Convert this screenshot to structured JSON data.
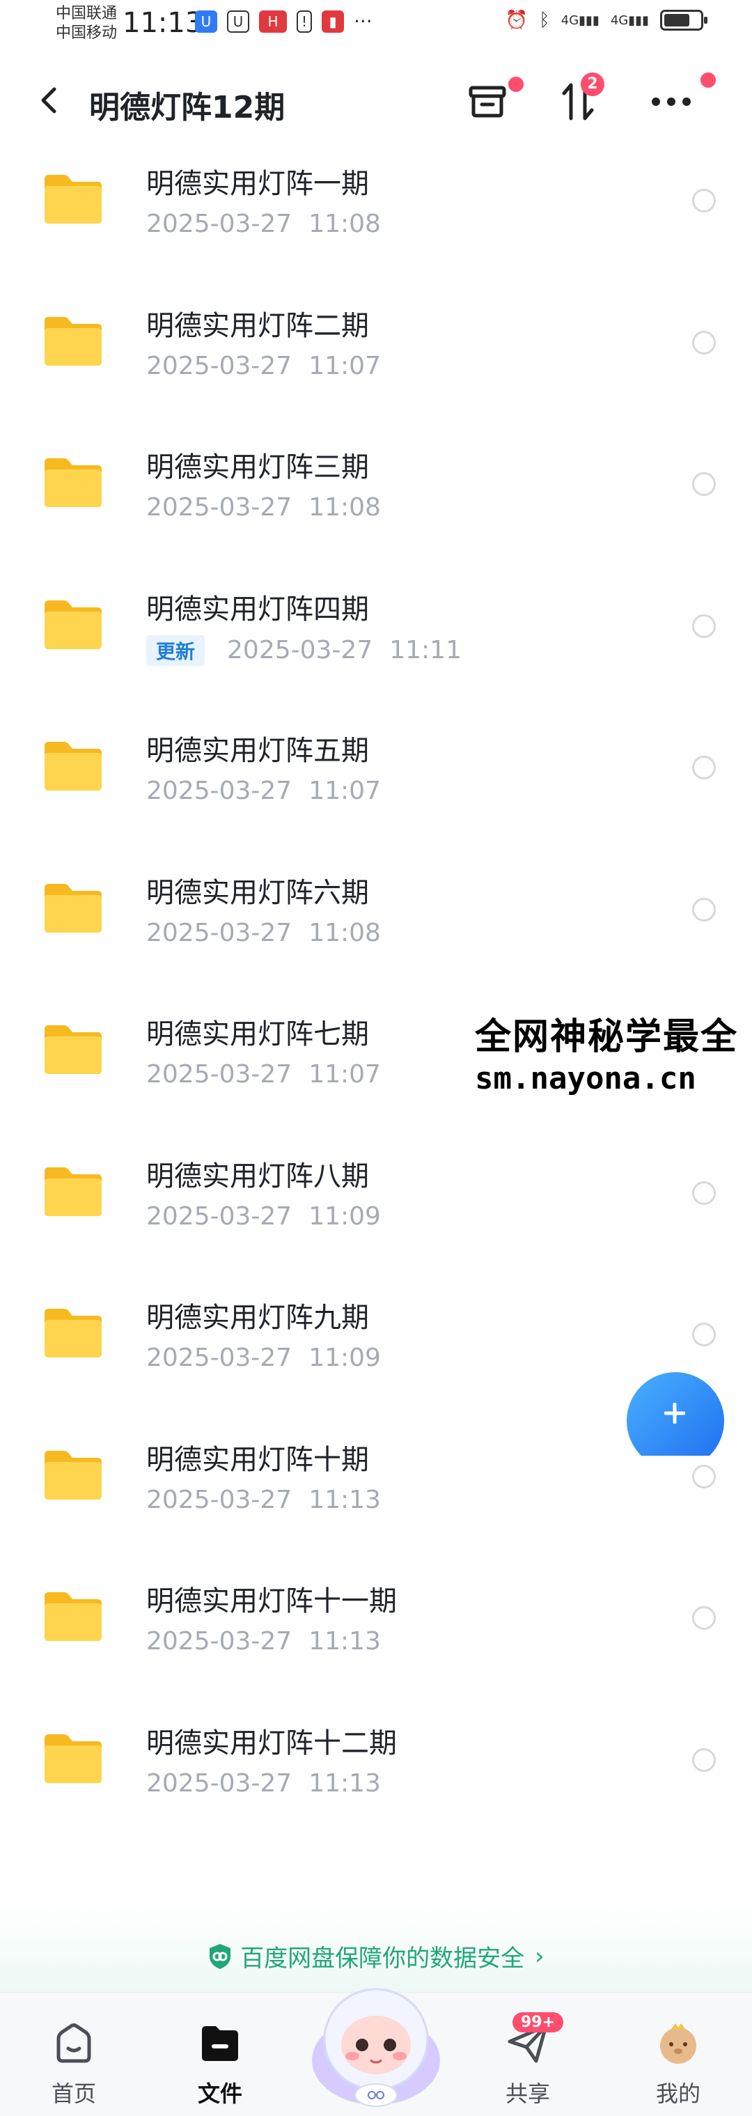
{
  "status_bar": {
    "carrier_line1": "中国联通",
    "carrier_line2": "中国移动",
    "time": "11:13",
    "network_labels": [
      "4G",
      "4G"
    ]
  },
  "header": {
    "title": "明德灯阵12期",
    "transfer_badge": "2"
  },
  "files": [
    {
      "name": "明德实用灯阵一期",
      "date": "2025-03-27",
      "time": "11:08",
      "tag": ""
    },
    {
      "name": "明德实用灯阵二期",
      "date": "2025-03-27",
      "time": "11:07",
      "tag": ""
    },
    {
      "name": "明德实用灯阵三期",
      "date": "2025-03-27",
      "time": "11:08",
      "tag": ""
    },
    {
      "name": "明德实用灯阵四期",
      "date": "2025-03-27",
      "time": "11:11",
      "tag": "更新"
    },
    {
      "name": "明德实用灯阵五期",
      "date": "2025-03-27",
      "time": "11:07",
      "tag": ""
    },
    {
      "name": "明德实用灯阵六期",
      "date": "2025-03-27",
      "time": "11:08",
      "tag": ""
    },
    {
      "name": "明德实用灯阵七期",
      "date": "2025-03-27",
      "time": "11:07",
      "tag": ""
    },
    {
      "name": "明德实用灯阵八期",
      "date": "2025-03-27",
      "time": "11:09",
      "tag": ""
    },
    {
      "name": "明德实用灯阵九期",
      "date": "2025-03-27",
      "time": "11:09",
      "tag": ""
    },
    {
      "name": "明德实用灯阵十期",
      "date": "2025-03-27",
      "time": "11:13",
      "tag": ""
    },
    {
      "name": "明德实用灯阵十一期",
      "date": "2025-03-27",
      "time": "11:13",
      "tag": ""
    },
    {
      "name": "明德实用灯阵十二期",
      "date": "2025-03-27",
      "time": "11:13",
      "tag": ""
    }
  ],
  "watermark": {
    "line1": "全网神秘学最全",
    "line2": "sm.nayona.cn"
  },
  "security_banner": {
    "text": "百度网盘保障你的数据安全"
  },
  "bottom_nav": {
    "home": "首页",
    "files": "文件",
    "share": "共享",
    "share_badge": "99+",
    "mine": "我的"
  },
  "colors": {
    "folder": "#ffc933",
    "accent": "#1e6ef0",
    "badge": "#ff4d6d",
    "security": "#21a67a"
  }
}
